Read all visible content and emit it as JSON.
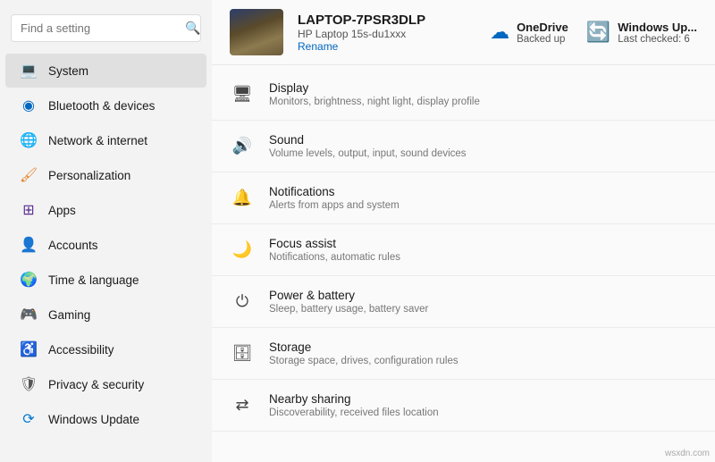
{
  "search": {
    "placeholder": "Find a setting",
    "icon": "🔍"
  },
  "sidebar": {
    "items": [
      {
        "id": "system",
        "label": "System",
        "icon": "💻",
        "active": true,
        "iconClass": "icon-system"
      },
      {
        "id": "bluetooth",
        "label": "Bluetooth & devices",
        "icon": "◉",
        "active": false,
        "iconClass": "icon-bluetooth"
      },
      {
        "id": "network",
        "label": "Network & internet",
        "icon": "🌐",
        "active": false,
        "iconClass": "icon-network"
      },
      {
        "id": "personalization",
        "label": "Personalization",
        "icon": "🖌",
        "active": false,
        "iconClass": "icon-personalization"
      },
      {
        "id": "apps",
        "label": "Apps",
        "icon": "📦",
        "active": false,
        "iconClass": "icon-apps"
      },
      {
        "id": "accounts",
        "label": "Accounts",
        "icon": "👤",
        "active": false,
        "iconClass": "icon-accounts"
      },
      {
        "id": "time",
        "label": "Time & language",
        "icon": "🌍",
        "active": false,
        "iconClass": "icon-time"
      },
      {
        "id": "gaming",
        "label": "Gaming",
        "icon": "🎮",
        "active": false,
        "iconClass": "icon-gaming"
      },
      {
        "id": "accessibility",
        "label": "Accessibility",
        "icon": "♿",
        "active": false,
        "iconClass": "icon-accessibility"
      },
      {
        "id": "privacy",
        "label": "Privacy & security",
        "icon": "🛡",
        "active": false,
        "iconClass": "icon-privacy"
      },
      {
        "id": "update",
        "label": "Windows Update",
        "icon": "⟳",
        "active": false,
        "iconClass": "icon-update"
      }
    ]
  },
  "device": {
    "name": "LAPTOP-7PSR3DLP",
    "model": "HP Laptop 15s-du1xxx",
    "rename_label": "Rename"
  },
  "widgets": [
    {
      "id": "onedrive",
      "title": "OneDrive",
      "status": "Backed up",
      "icon": "☁"
    },
    {
      "id": "winupdate",
      "title": "Windows Up...",
      "status": "Last checked: 6",
      "icon": "🔄"
    }
  ],
  "settings": [
    {
      "id": "display",
      "icon": "🖥",
      "title": "Display",
      "subtitle": "Monitors, brightness, night light, display profile"
    },
    {
      "id": "sound",
      "icon": "🔊",
      "title": "Sound",
      "subtitle": "Volume levels, output, input, sound devices"
    },
    {
      "id": "notifications",
      "icon": "🔔",
      "title": "Notifications",
      "subtitle": "Alerts from apps and system"
    },
    {
      "id": "focus",
      "icon": "🌙",
      "title": "Focus assist",
      "subtitle": "Notifications, automatic rules"
    },
    {
      "id": "power",
      "icon": "⏻",
      "title": "Power & battery",
      "subtitle": "Sleep, battery usage, battery saver"
    },
    {
      "id": "storage",
      "icon": "🗄",
      "title": "Storage",
      "subtitle": "Storage space, drives, configuration rules"
    },
    {
      "id": "nearby",
      "icon": "⇄",
      "title": "Nearby sharing",
      "subtitle": "Discoverability, received files location"
    }
  ],
  "watermark": "wsxdn.com"
}
